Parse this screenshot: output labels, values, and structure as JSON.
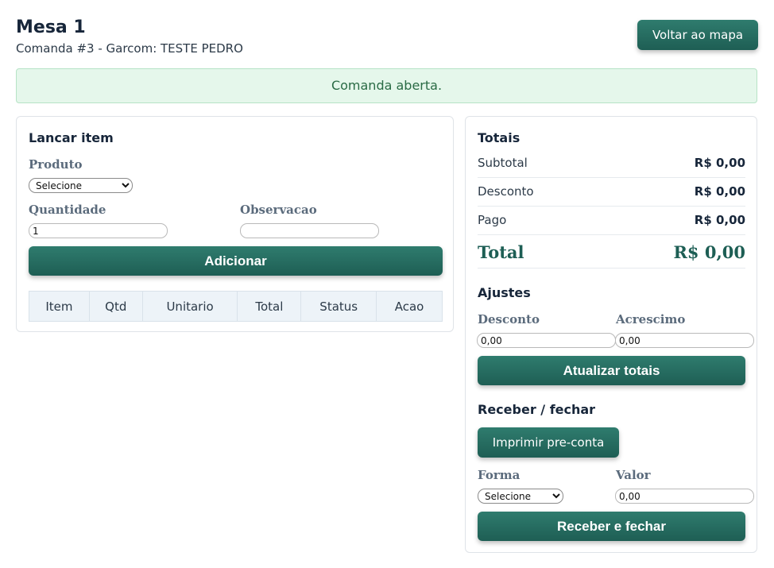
{
  "header": {
    "title": "Mesa 1",
    "subtitle": "Comanda #3 - Garcom: TESTE PEDRO",
    "back_button": "Voltar ao mapa"
  },
  "alert": {
    "message": "Comanda aberta."
  },
  "launch": {
    "title": "Lancar item",
    "product_label": "Produto",
    "product_selected": "Selecione",
    "quantity_label": "Quantidade",
    "quantity_value": "1",
    "note_label": "Observacao",
    "note_value": "",
    "add_button": "Adicionar",
    "table_headers": [
      "Item",
      "Qtd",
      "Unitario",
      "Total",
      "Status",
      "Acao"
    ]
  },
  "totals": {
    "title": "Totais",
    "rows": [
      {
        "label": "Subtotal",
        "value": "R$ 0,00"
      },
      {
        "label": "Desconto",
        "value": "R$ 0,00"
      },
      {
        "label": "Pago",
        "value": "R$ 0,00"
      }
    ],
    "total_label": "Total",
    "total_value": "R$ 0,00"
  },
  "adjustments": {
    "title": "Ajustes",
    "discount_label": "Desconto",
    "discount_value": "0,00",
    "surcharge_label": "Acrescimo",
    "surcharge_value": "0,00",
    "update_button": "Atualizar totais"
  },
  "close": {
    "title": "Receber / fechar",
    "print_button": "Imprimir pre-conta",
    "method_label": "Forma",
    "method_selected": "Selecione",
    "amount_label": "Valor",
    "amount_value": "0,00",
    "submit_button": "Receber e fechar"
  },
  "colors": {
    "primary": "#26695e",
    "alert_bg": "#e5f7eb",
    "alert_text": "#2a6b45",
    "table_header_bg": "#edf3f8"
  }
}
